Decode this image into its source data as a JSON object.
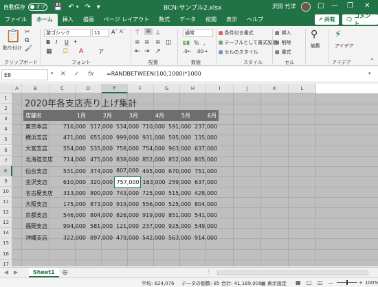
{
  "titlebar": {
    "autosave_label": "自動保存",
    "autosave_state": "オフ",
    "filename": "BCN-サンプル2.xlsx",
    "user_name": "沢田 竹洋",
    "icons": [
      "save-icon",
      "undo-icon",
      "redo-icon",
      "minimize-icon",
      "restore-icon",
      "close-icon"
    ]
  },
  "tabs": [
    "ファイル",
    "ホーム",
    "挿入",
    "描画",
    "ページ レイアウト",
    "数式",
    "データ",
    "校閲",
    "表示",
    "ヘルプ"
  ],
  "active_tab": "ホーム",
  "share_label": "共有",
  "comment_label": "コメント",
  "ribbon": {
    "paste_label": "貼り付け",
    "clipboard_label": "クリップボード",
    "font_name": "游ゴシック",
    "font_size": "11",
    "font_label": "フォント",
    "align_label": "配置",
    "numfmt_value": "通常",
    "number_label": "数値",
    "cond_format": "条件付き書式",
    "table_format": "テーブルとして書式設定",
    "cell_style": "セルのスタイル",
    "style_label": "スタイル",
    "insert_label": "挿入",
    "delete_label": "削除",
    "format_label": "書式",
    "cells_label": "セル",
    "edit_label": "編集",
    "ideas_label": "アイデア",
    "ideas_group_label": "アイデア"
  },
  "formulabar": {
    "namebox": "E8",
    "fx": "fx",
    "formula": "=RANDBETWEEN(100,1000)*1000"
  },
  "columns": [
    "A",
    "B",
    "C",
    "D",
    "E",
    "F",
    "G",
    "H",
    "I",
    "J",
    "K",
    "L"
  ],
  "rows": [
    "1",
    "2",
    "3",
    "4",
    "5",
    "6",
    "7",
    "8",
    "9",
    "10",
    "11",
    "12",
    "13",
    "14",
    "15",
    "16",
    "17"
  ],
  "sheet": {
    "title": "2020年各支店売り上げ集計",
    "header": [
      "店舗名",
      "1月",
      "2月",
      "3月",
      "4月",
      "5月",
      "6月"
    ],
    "data": [
      [
        "東京本店",
        "716,000",
        "517,000",
        "534,000",
        "710,000",
        "591,000",
        "237,000"
      ],
      [
        "横浜支店",
        "471,000",
        "655,000",
        "999,000",
        "931,000",
        "595,000",
        "135,000"
      ],
      [
        "大宮支店",
        "554,000",
        "535,000",
        "758,000",
        "754,000",
        "963,000",
        "637,000"
      ],
      [
        "北海道支店",
        "714,000",
        "475,000",
        "838,000",
        "852,000",
        "852,000",
        "805,000"
      ],
      [
        "仙台支店",
        "531,000",
        "374,000",
        "807,000",
        "495,000",
        "670,000",
        "751,000"
      ],
      [
        "金沢支店",
        "610,000",
        "320,000",
        "757,000",
        "163,000",
        "259,000",
        "637,000"
      ],
      [
        "名古屋支店",
        "313,000",
        "800,000",
        "743,000",
        "725,000",
        "515,000",
        "428,000"
      ],
      [
        "大阪支店",
        "175,000",
        "873,000",
        "919,000",
        "556,000",
        "525,000",
        "804,000"
      ],
      [
        "京都支店",
        "546,000",
        "804,000",
        "826,000",
        "919,000",
        "851,000",
        "541,000"
      ],
      [
        "福岡支店",
        "994,000",
        "581,000",
        "121,000",
        "237,000",
        "925,000",
        "549,000"
      ],
      [
        "沖縄支店",
        "322,000",
        "897,000",
        "479,000",
        "542,000",
        "563,000",
        "914,000"
      ]
    ],
    "selected_cell": "757,000"
  },
  "sheet_tab": "Sheet1",
  "status": {
    "average": "平均: 624,076",
    "count": "データの個数: 85",
    "sum": "合計: 41,189,000",
    "display_settings": "表示設定",
    "zoom": "100%"
  },
  "colors": {
    "excel_green": "#217346",
    "header_fill": "#6e6e6e",
    "sheet_fill": "#bfbfbf"
  }
}
